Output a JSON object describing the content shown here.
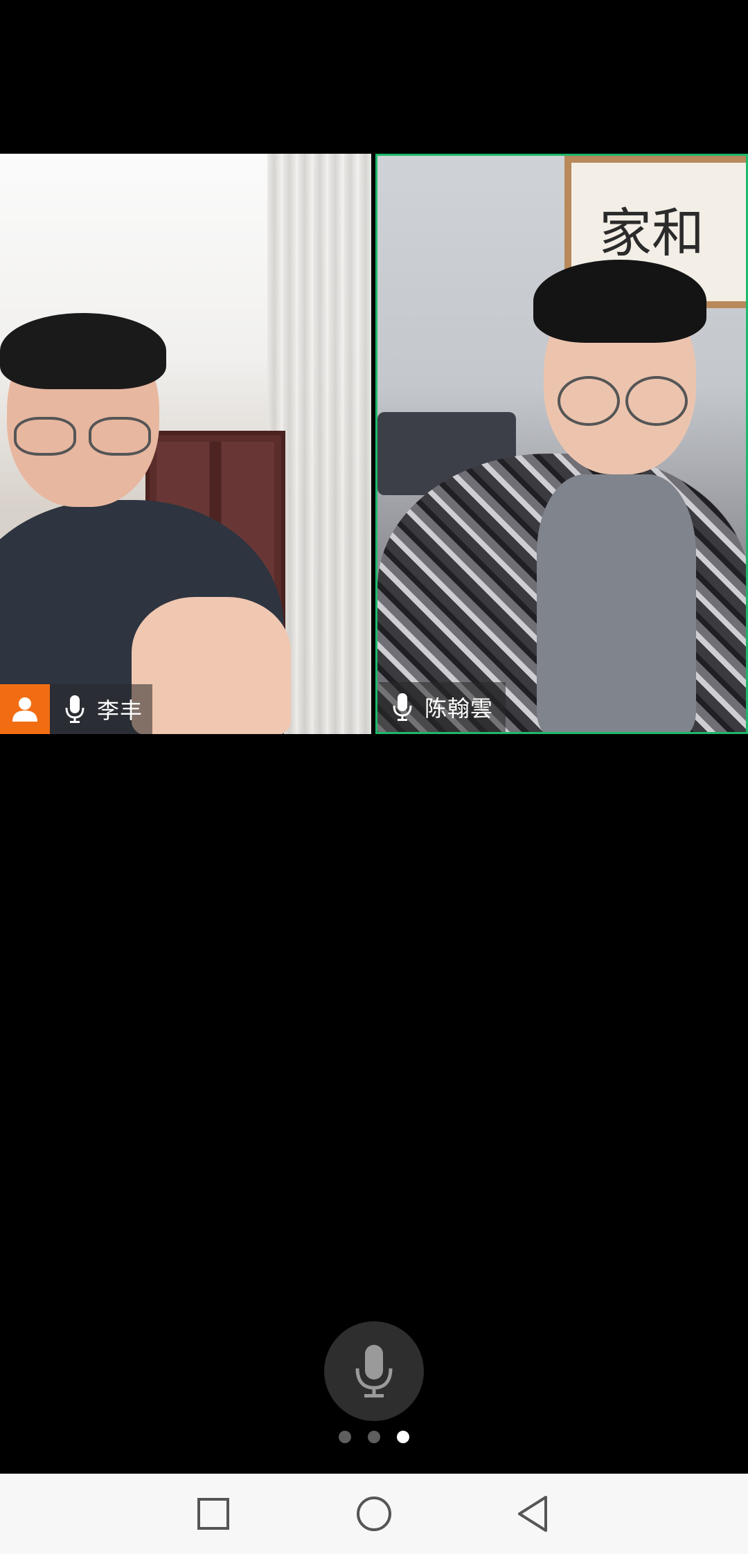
{
  "participants": [
    {
      "name": "李丰",
      "is_host": true,
      "mic": "on"
    },
    {
      "name": "陈翰雲",
      "is_host": false,
      "mic": "on",
      "active_speaker": true
    }
  ],
  "controls": {
    "mic_button_icon": "microphone-icon"
  },
  "pagination": {
    "total": 3,
    "current": 3
  },
  "system_nav": {
    "recent_icon": "square-icon",
    "home_icon": "circle-icon",
    "back_icon": "triangle-back-icon"
  },
  "colors": {
    "host_badge": "#f26d12",
    "active_border": "#1fb86a",
    "background": "#000000",
    "nav_bar": "#f7f7f7"
  },
  "painting_text": "家和"
}
